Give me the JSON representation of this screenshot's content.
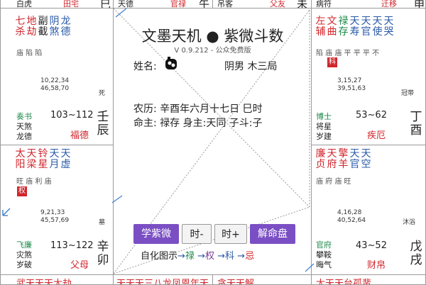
{
  "top_strip": {
    "c1_left": "白虎",
    "c1_right": "田宅",
    "c1_branch": "巳",
    "c2_left": "天德",
    "c2_right": "官禄",
    "c2_branch": "午",
    "c3_left": "吊客",
    "c3_right": "父友",
    "c3_branch": "未",
    "c4_left": "病符",
    "c4_right": "迁移",
    "c4_branch": "申"
  },
  "palaces": {
    "chen": {
      "stars": [
        {
          "chars": "七杀",
          "color": "red"
        },
        {
          "chars": "地劫",
          "color": "red"
        },
        {
          "chars": "副截",
          "color": "black"
        },
        {
          "chars": "阴煞",
          "color": "blue"
        },
        {
          "chars": "龙德",
          "color": "blue"
        }
      ],
      "brightness": "庙 陷 陷",
      "numbers": "10,22,34\n46,58,70",
      "stage": "死",
      "lower": [
        "奏书",
        "天煞",
        "龙德"
      ],
      "range": "103~112",
      "name": "福德",
      "stem": "壬",
      "branch": "辰"
    },
    "mao": {
      "stars": [
        {
          "chars": "太阳",
          "color": "red"
        },
        {
          "chars": "天梁",
          "color": "red"
        },
        {
          "chars": "铃星",
          "color": "red"
        },
        {
          "chars": "天月",
          "color": "blue"
        },
        {
          "chars": "天虚",
          "color": "blue"
        }
      ],
      "brightness": "旺 庙 利   庙",
      "tag": "权",
      "numbers": "9,21,33\n45,57,69",
      "stage": "墓",
      "lower": [
        "飞廉",
        "灾煞",
        "岁破"
      ],
      "range": "113~122",
      "name": "父母",
      "stem": "辛",
      "branch": "卯"
    },
    "you": {
      "stars": [
        {
          "chars": "左辅",
          "color": "red"
        },
        {
          "chars": "文曲",
          "color": "red"
        },
        {
          "chars": "禄存",
          "color": "green"
        },
        {
          "chars": "天寿",
          "color": "blue"
        },
        {
          "chars": "天官",
          "color": "blue"
        },
        {
          "chars": "天使",
          "color": "blue"
        },
        {
          "chars": "天哭",
          "color": "blue"
        }
      ],
      "brightness": "陷 庙 庙 平 平 平 不",
      "tag": "科",
      "numbers": "3,15,27\n39,51,63",
      "stage": "冠带",
      "lower": [
        "博士",
        "将星",
        "岁建"
      ],
      "range": "53~62",
      "name": "疾厄",
      "stem": "丁",
      "branch": "酉"
    },
    "xu": {
      "stars": [
        {
          "chars": "廉贞",
          "color": "red"
        },
        {
          "chars": "天府",
          "color": "red"
        },
        {
          "chars": "擎羊",
          "color": "red"
        },
        {
          "chars": "天官",
          "color": "blue"
        },
        {
          "chars": "天空",
          "color": "blue"
        }
      ],
      "brightness": "庙 府 庙 旺",
      "numbers": "4,16,28\n40,52,64",
      "stage": "沐浴",
      "lower": [
        "官府",
        "攀鞍",
        "晦气"
      ],
      "range": "43~52",
      "name": "财帛",
      "stem": "戊",
      "branch": "戌"
    }
  },
  "bottom_strip": {
    "left": "武天天天大劫",
    "mid": "天天天三八龙凤恩年天",
    "right1": "贪天天解",
    "right2": "太天天台孤蜚"
  },
  "center": {
    "title": "文墨天机 ● 紫微斗数",
    "version": "V 0.9.212 - 公众免费版",
    "name_label": "姓名:",
    "gender": "阴男 木三局",
    "lunar": "农历: 辛酉年六月十七日 巳时",
    "ming": "命主: 禄存 身主:天同 子斗:子",
    "buttons": {
      "xue": "学紫微",
      "prev": "时-",
      "next": "时+",
      "jie": "解命盘"
    },
    "legend": {
      "label": "自化图示",
      "lu": "禄",
      "quan": "权",
      "ke": "科",
      "ji": "忌"
    }
  },
  "colors": {
    "red": "#d0262c",
    "blue": "#2a5aa8",
    "green": "#1d8a4a",
    "purple": "#7b4fc4",
    "ji_red": "#d0262c"
  }
}
